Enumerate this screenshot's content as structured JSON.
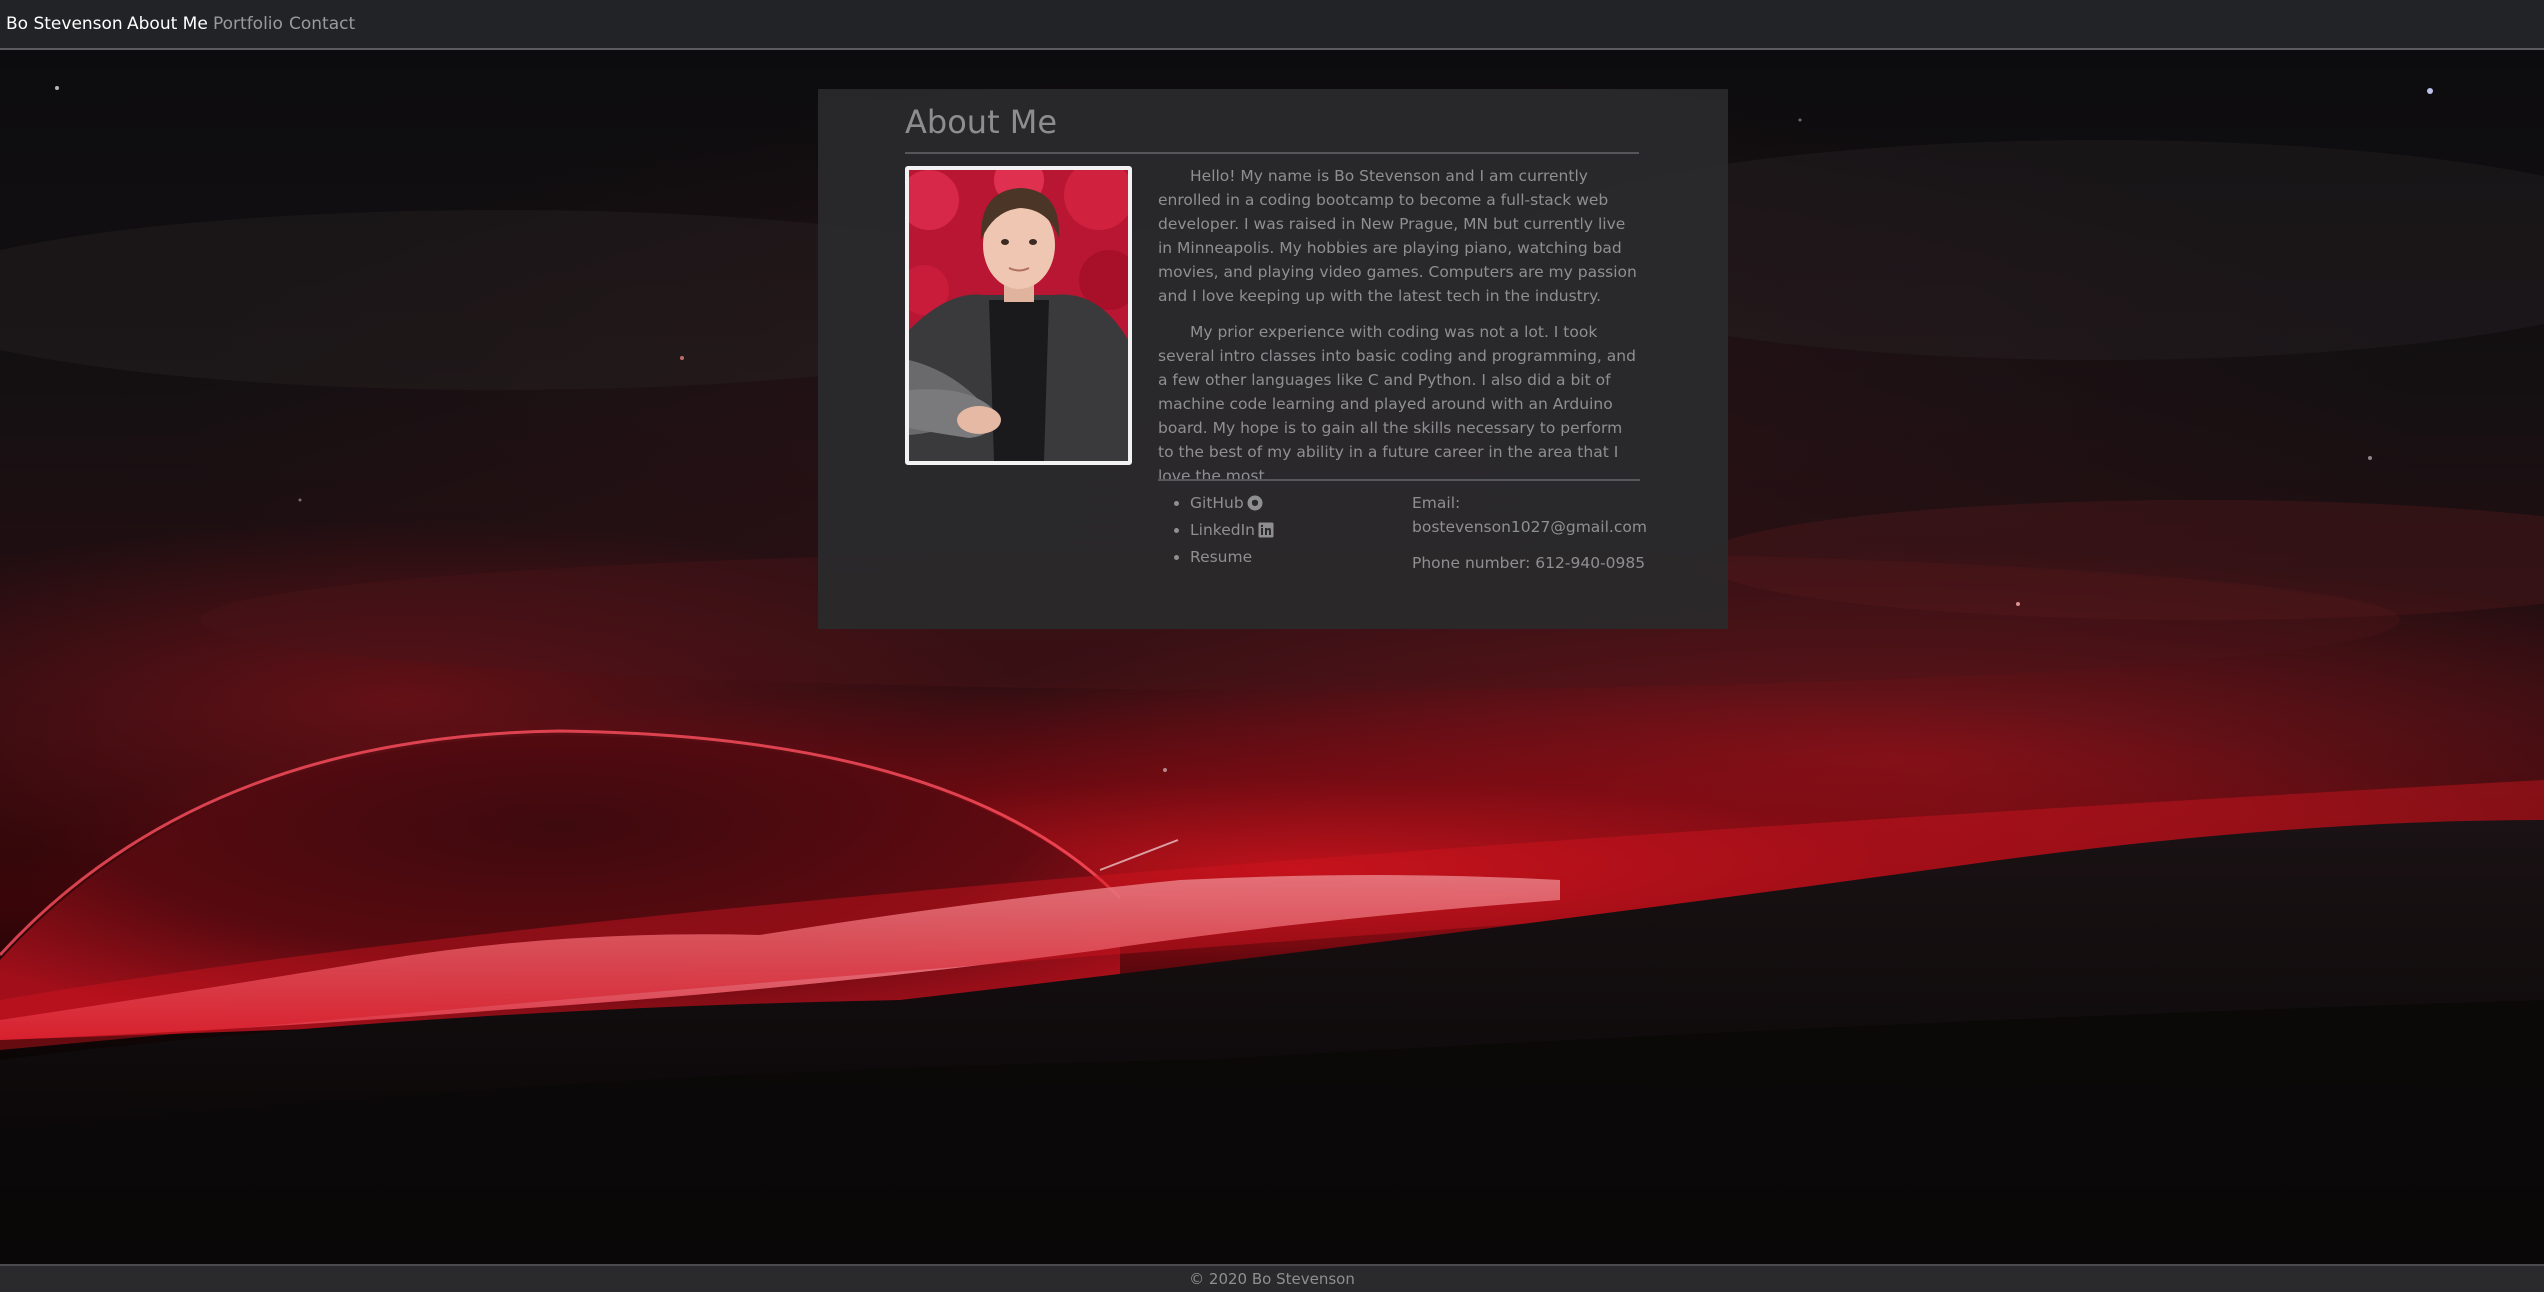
{
  "nav": {
    "brand": "Bo Stevenson",
    "links": [
      {
        "label": "About Me",
        "active": true
      },
      {
        "label": "Portfolio",
        "active": false
      },
      {
        "label": "Contact",
        "active": false
      }
    ]
  },
  "about": {
    "title": "About Me",
    "photo_icon": "portrait-photo",
    "paragraphs": [
      "Hello! My name is Bo Stevenson and I am currently enrolled in a coding bootcamp to become a full-stack web developer. I was raised in New Prague, MN but currently live in Minneapolis. My hobbies are playing piano, watching bad movies, and playing video games. Computers are my passion and I love keeping up with the latest tech in the industry.",
      "My prior experience with coding was not a lot. I took several intro classes into basic coding and programming, and a few other languages like C and Python. I also did a bit of machine code learning and played around with an Arduino board. My hope is to gain all the skills necessary to perform to the best of my ability in a future career in the area that I love the most."
    ],
    "links": [
      {
        "label": "GitHub",
        "icon": "github-icon"
      },
      {
        "label": "LinkedIn",
        "icon": "linkedin-icon"
      },
      {
        "label": "Resume",
        "icon": ""
      }
    ],
    "email_label": "Email:",
    "email": "bostevenson1027@gmail.com",
    "phone": "Phone number: 612-940-0985"
  },
  "footer": {
    "text": "© 2020 Bo Stevenson"
  },
  "colors": {
    "navbar_bg": "#222326",
    "card_bg": "#2a2a2c",
    "text_muted": "#8f8f92",
    "accent_red": "#c8141e"
  }
}
